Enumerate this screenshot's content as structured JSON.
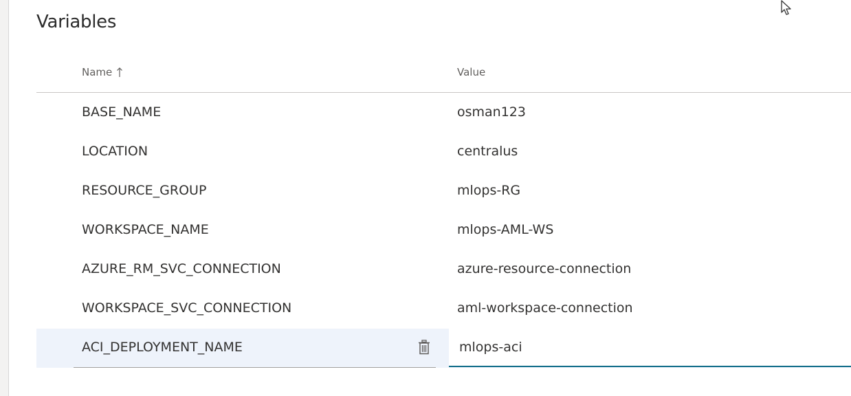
{
  "page": {
    "title": "Variables"
  },
  "table": {
    "headers": {
      "name": "Name",
      "value": "Value",
      "sort_icon": "arrow-up-icon"
    },
    "rows": [
      {
        "name": "BASE_NAME",
        "value": "osman123"
      },
      {
        "name": "LOCATION",
        "value": "centralus"
      },
      {
        "name": "RESOURCE_GROUP",
        "value": "mlops-RG"
      },
      {
        "name": "WORKSPACE_NAME",
        "value": "mlops-AML-WS"
      },
      {
        "name": "AZURE_RM_SVC_CONNECTION",
        "value": "azure-resource-connection"
      },
      {
        "name": "WORKSPACE_SVC_CONNECTION",
        "value": "aml-workspace-connection"
      }
    ],
    "selected_row": {
      "name": "ACI_DEPLOYMENT_NAME",
      "value": "mlops-aci",
      "delete_icon": "trash-icon"
    }
  },
  "colors": {
    "selected_row_bg": "#eef3fb",
    "focus_underline": "#0f6c88",
    "header_text": "#605e5c",
    "body_text": "#323130"
  },
  "icons": {
    "cursor": "mouse-pointer-icon"
  }
}
